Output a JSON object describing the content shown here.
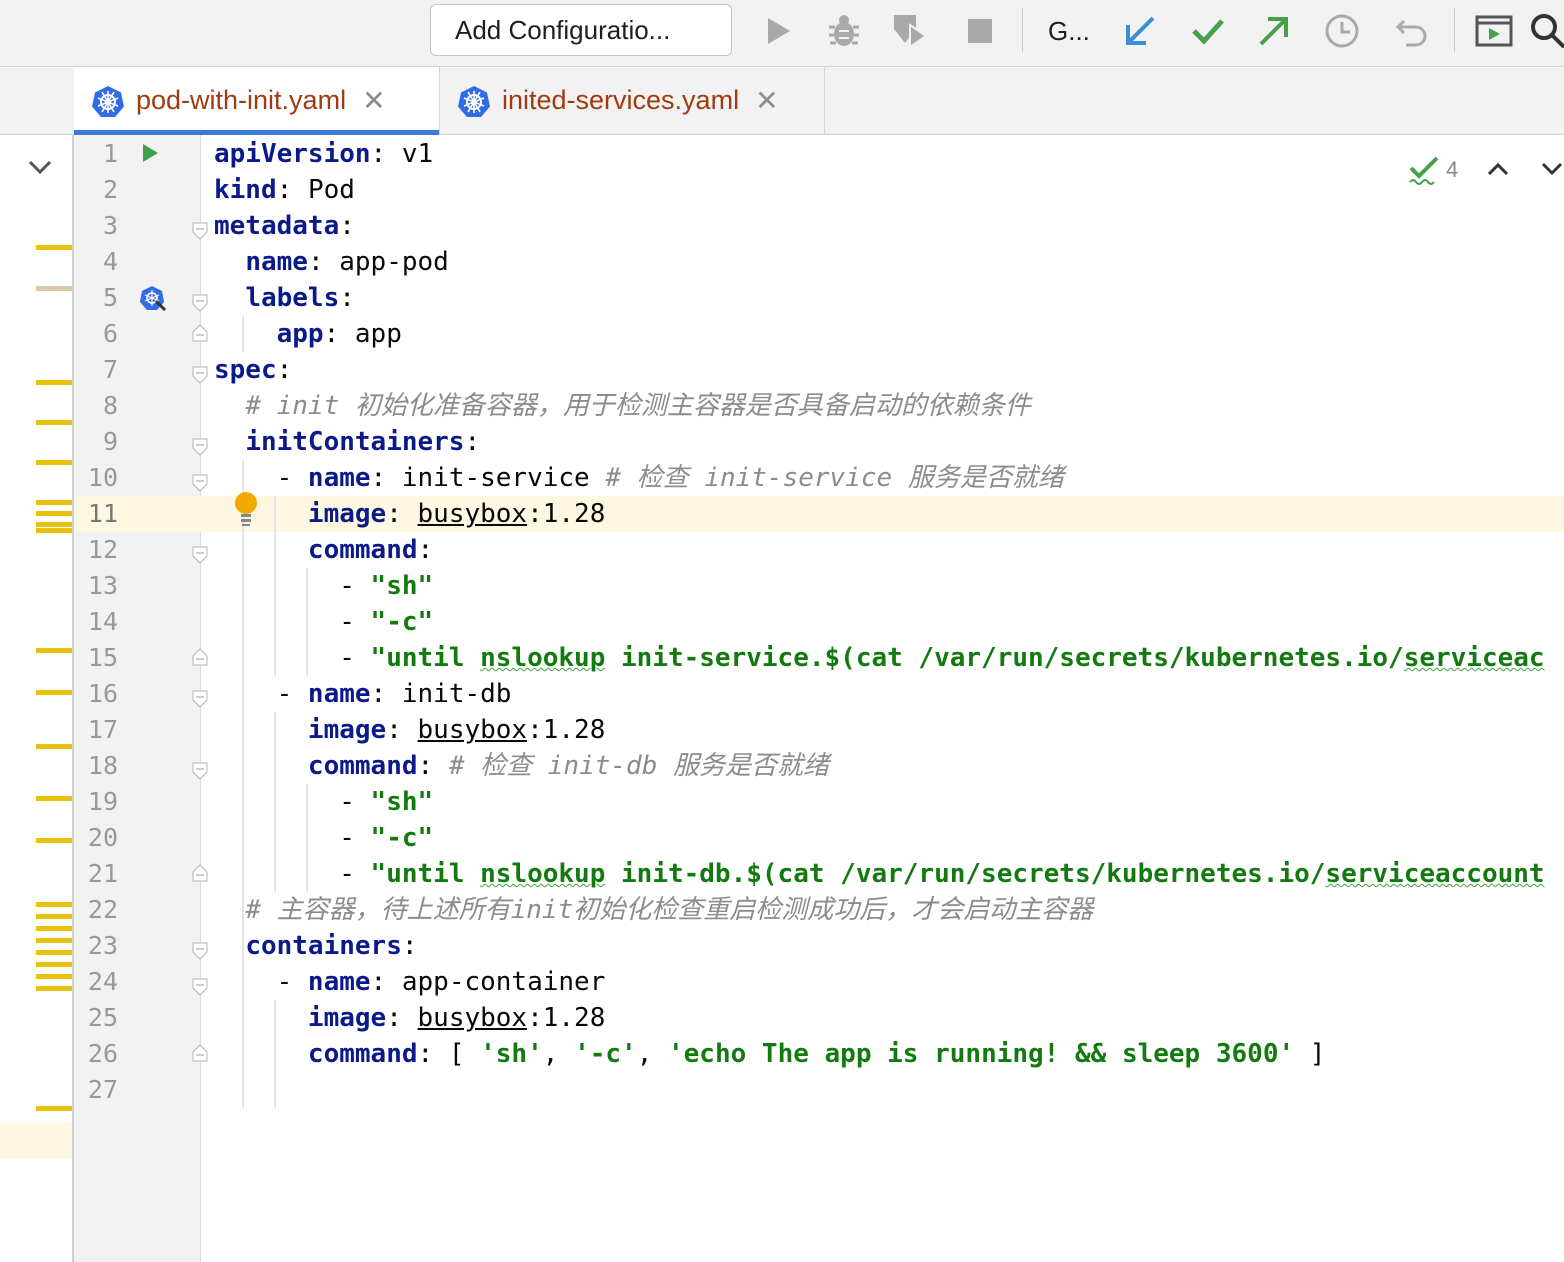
{
  "toolbar": {
    "run_config_label": "Add Configuratio...",
    "vcs_label": "G...",
    "icons": [
      "run-icon",
      "debug-icon",
      "coverage-icon",
      "stop-icon",
      "vcs-update-icon",
      "vcs-commit-icon",
      "vcs-push-icon",
      "history-icon",
      "rollback-icon",
      "presentation-icon",
      "search-icon"
    ]
  },
  "tabs": [
    {
      "label": "pod-with-init.yaml",
      "active": true
    },
    {
      "label": "inited-services.yaml",
      "active": false
    }
  ],
  "inspections": {
    "count": "4"
  },
  "editor": {
    "current_line": 11,
    "lines": [
      {
        "n": "1"
      },
      {
        "n": "2"
      },
      {
        "n": "3"
      },
      {
        "n": "4"
      },
      {
        "n": "5"
      },
      {
        "n": "6"
      },
      {
        "n": "7"
      },
      {
        "n": "8"
      },
      {
        "n": "9"
      },
      {
        "n": "10"
      },
      {
        "n": "11"
      },
      {
        "n": "12"
      },
      {
        "n": "13"
      },
      {
        "n": "14"
      },
      {
        "n": "15"
      },
      {
        "n": "16"
      },
      {
        "n": "17"
      },
      {
        "n": "18"
      },
      {
        "n": "19"
      },
      {
        "n": "20"
      },
      {
        "n": "21"
      },
      {
        "n": "22"
      },
      {
        "n": "23"
      },
      {
        "n": "24"
      },
      {
        "n": "25"
      },
      {
        "n": "26"
      },
      {
        "n": "27"
      }
    ],
    "code": {
      "l1_key": "apiVersion",
      "l1_val": "v1",
      "l2_key": "kind",
      "l2_val": "Pod",
      "l3_key": "metadata",
      "l4_key": "name",
      "l4_val": "app-pod",
      "l5_key": "labels",
      "l6_key": "app",
      "l6_val": "app",
      "l7_key": "spec",
      "l8_comment": "# init 初始化准备容器，用于检测主容器是否具备启动的依赖条件",
      "l9_key": "initContainers",
      "l10_key": "name",
      "l10_val": "init-service",
      "l10_comment": "# 检查 init-service 服务是否就绪",
      "l11_key": "image",
      "l11_val_a": "busybox",
      "l11_val_b": ":1.28",
      "l12_key": "command",
      "l13_val": "\"sh\"",
      "l14_val": "\"-c\"",
      "l15_val_a": "\"until ",
      "l15_val_b": "nslookup",
      "l15_val_c": " init-service.$(cat /var/run/secrets/kubernetes.io/",
      "l15_val_d": "serviceac",
      "l16_key": "name",
      "l16_val": "init-db",
      "l17_key": "image",
      "l17_val_a": "busybox",
      "l17_val_b": ":1.28",
      "l18_key": "command",
      "l18_comment": "# 检查 init-db 服务是否就绪",
      "l19_val": "\"sh\"",
      "l20_val": "\"-c\"",
      "l21_val_a": "\"until ",
      "l21_val_b": "nslookup",
      "l21_val_c": " init-db.$(cat /var/run/secrets/kubernetes.io/",
      "l21_val_d": "serviceaccount",
      "l22_comment": "# 主容器，待上述所有init初始化检查重启检测成功后，才会启动主容器",
      "l23_key": "containers",
      "l24_key": "name",
      "l24_val": "app-container",
      "l25_key": "image",
      "l25_val_a": "busybox",
      "l25_val_b": ":1.28",
      "l26_key": "command",
      "l26_open": "[ ",
      "l26_s1": "'sh'",
      "l26_comma1": ", ",
      "l26_s2": "'-c'",
      "l26_comma2": ", ",
      "l26_s3": "'echo The app is running! && sleep 3600'",
      "l26_close": " ]"
    }
  },
  "colors": {
    "keyword": "#0b1a8a",
    "string": "#137a10",
    "comment": "#8c8c8c",
    "tab_label": "#a03a10",
    "active_tab_underline": "#3b7bd6",
    "current_line_bg": "#fef8e3",
    "warning_mark": "#e8c20d"
  }
}
